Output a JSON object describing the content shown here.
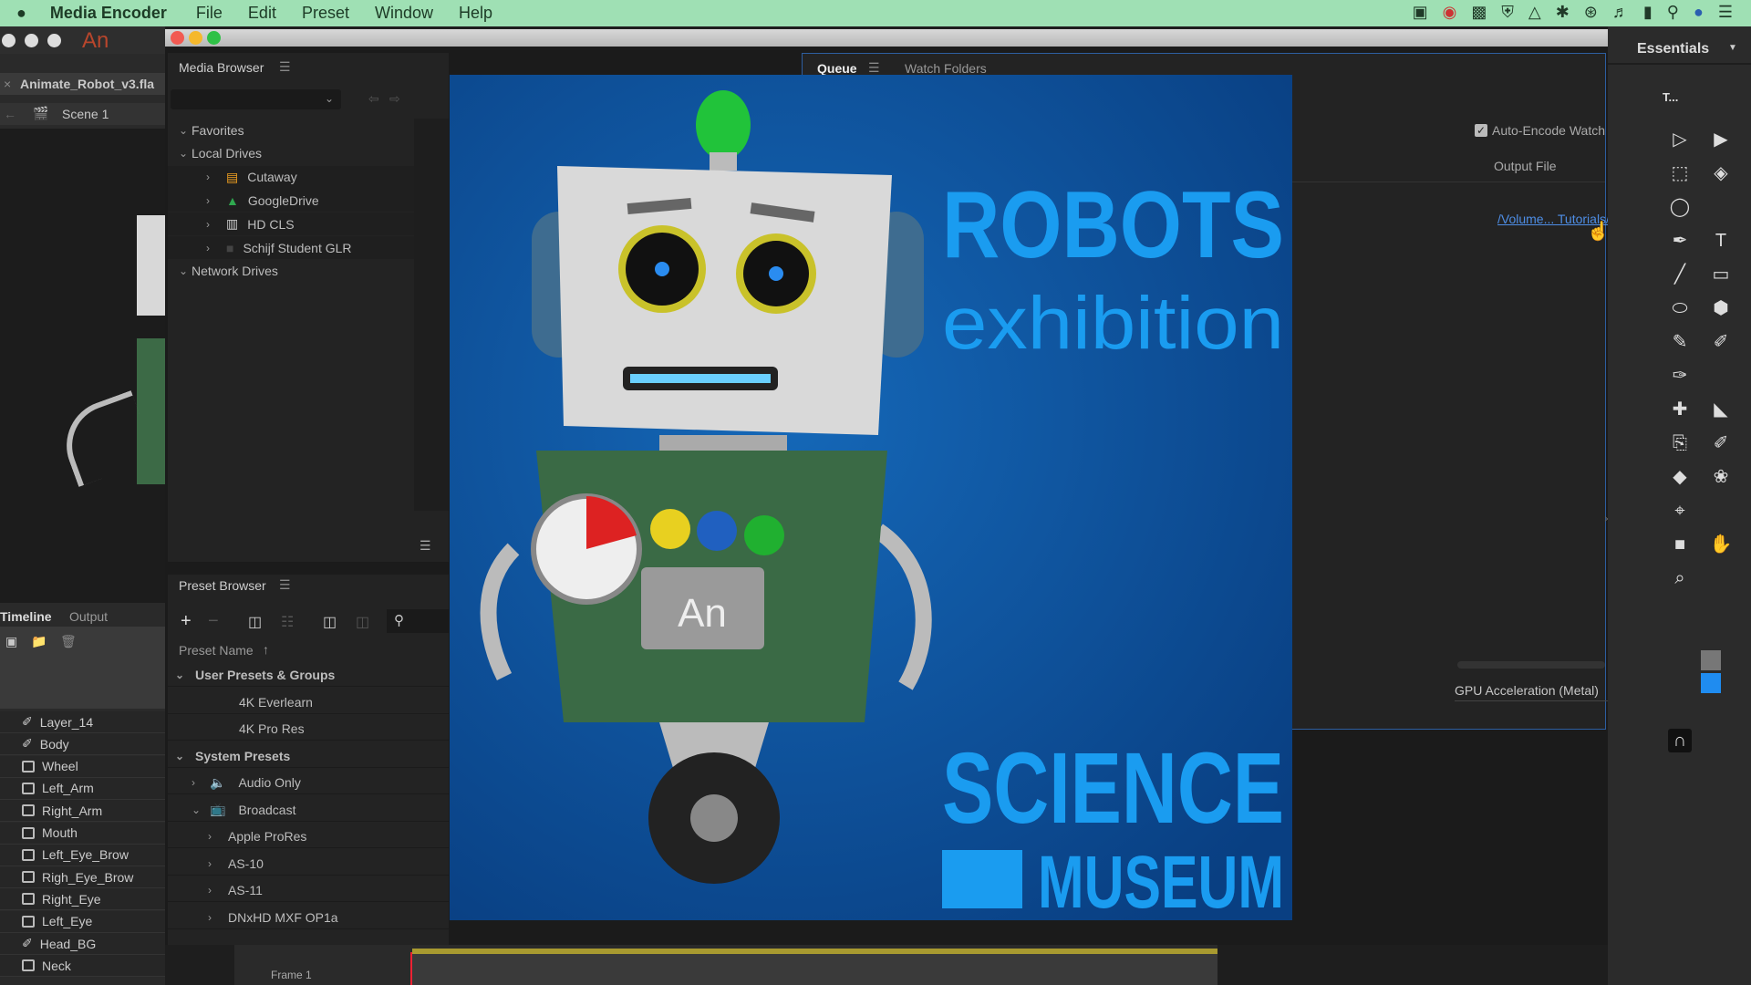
{
  "menubar": {
    "app": "Media Encoder",
    "items": [
      "File",
      "Edit",
      "Preset",
      "Window",
      "Help"
    ],
    "tray_icons": [
      "camera-icon",
      "creative-cloud-icon",
      "bi-icon",
      "shield-icon",
      "airplay-icon",
      "bluetooth-icon",
      "wifi-icon",
      "volume-icon",
      "battery-icon",
      "search-icon",
      "siri-icon",
      "list-icon"
    ]
  },
  "animate": {
    "logo": "An",
    "file_tab": "Animate_Robot_v3.fla",
    "scene": "Scene 1",
    "tabs": [
      "Timeline",
      "Output"
    ],
    "layers": [
      "Layer_14",
      "Body",
      "Wheel",
      "Left_Arm",
      "Right_Arm",
      "Mouth",
      "Left_Eye_Brow",
      "Righ_Eye_Brow",
      "Right_Eye",
      "Left_Eye",
      "Head_BG",
      "Neck"
    ],
    "guide_layers": [
      0,
      1,
      10
    ],
    "frame_label": "Frame 1"
  },
  "media_browser": {
    "title": "Media Browser",
    "tree": [
      {
        "label": "Favorites",
        "level": 0,
        "expanded": true
      },
      {
        "label": "Local Drives",
        "level": 0,
        "expanded": true
      },
      {
        "label": "Cutaway",
        "level": 1,
        "icon": "drive-orange-icon",
        "color": "#f0a020"
      },
      {
        "label": "GoogleDrive",
        "level": 1,
        "icon": "google-drive-icon"
      },
      {
        "label": "HD CLS",
        "level": 1,
        "icon": "hard-drive-icon"
      },
      {
        "label": "Schijf Student GLR",
        "level": 1,
        "icon": "network-drive-icon"
      },
      {
        "label": "Network Drives",
        "level": 0,
        "expanded": true
      }
    ]
  },
  "preset_browser": {
    "title": "Preset Browser",
    "column": "Preset Name",
    "rows": [
      {
        "label": "User Presets & Groups",
        "level": 0,
        "chev": "v"
      },
      {
        "label": "4K Everlearn",
        "level": 1,
        "chev": ""
      },
      {
        "label": "4K Pro Res",
        "level": 1,
        "chev": ""
      },
      {
        "label": "System Presets",
        "level": 0,
        "chev": "v"
      },
      {
        "label": "Audio Only",
        "level": 1,
        "chev": ">",
        "icon": "speaker-icon"
      },
      {
        "label": "Broadcast",
        "level": 1,
        "chev": "v",
        "icon": "tv-icon"
      },
      {
        "label": "Apple ProRes",
        "level": 2,
        "chev": ">"
      },
      {
        "label": "AS-10",
        "level": 2,
        "chev": ">"
      },
      {
        "label": "AS-11",
        "level": 2,
        "chev": ">"
      },
      {
        "label": "DNxHD MXF OP1a",
        "level": 2,
        "chev": ">"
      }
    ]
  },
  "queue": {
    "tabs": [
      "Queue",
      "Watch Folders"
    ],
    "active_tab": "Queue",
    "auto_encode": "Auto-Encode Watch Folders",
    "auto_encode_checked": true,
    "output_header": "Output File",
    "output_link": "/Volume... Tutorials/Robot/Animate_Robot_",
    "renderer": "GPU Acceleration (Metal)"
  },
  "poster": {
    "line1": "ROBOTS",
    "line2": "exhibition",
    "line3": "SCIENCE",
    "line4": "MUSEUM",
    "badge": "An",
    "bg": "#0d4f9a",
    "accent": "#1a9cf0"
  },
  "workspace": {
    "label": "Essentials"
  },
  "tools_panel": {
    "tab": "T..."
  }
}
